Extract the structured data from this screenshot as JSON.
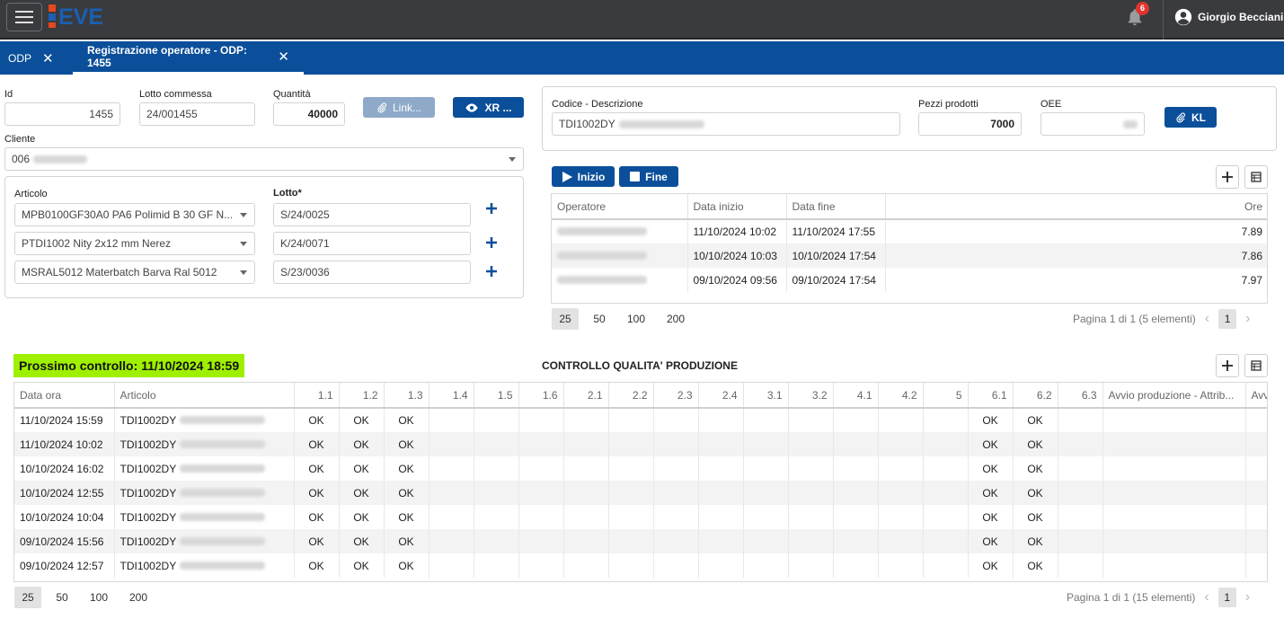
{
  "header": {
    "logo_text": "EVE",
    "notifications_count": "6",
    "user_name": "Giorgio Becciani"
  },
  "tabs": [
    {
      "label": "ODP"
    },
    {
      "label": "Registrazione operatore - ODP: 1455"
    }
  ],
  "form": {
    "id_label": "Id",
    "id_value": "1455",
    "lotto_commessa_label": "Lotto commessa",
    "lotto_commessa_value": "24/001455",
    "quantita_label": "Quantità",
    "quantita_value": "40000",
    "link_button": "Link...",
    "xr_button": "XR ...",
    "cliente_label": "Cliente",
    "cliente_value": "006",
    "articolo_label": "Articolo",
    "lotto_label": "Lotto*",
    "articles": [
      {
        "articolo": "MPB0100GF30A0 PA6 Polimid B 30 GF N...",
        "lotto": "S/24/0025"
      },
      {
        "articolo": "PTDI1002 Nity 2x12 mm Nerez",
        "lotto": "K/24/0071"
      },
      {
        "articolo": "MSRAL5012 Materbatch Barva Ral 5012",
        "lotto": "S/23/0036"
      }
    ]
  },
  "product": {
    "codice_label": "Codice - Descrizione",
    "codice_value": "TDI1002DY",
    "pezzi_label": "Pezzi prodotti",
    "pezzi_value": "7000",
    "oee_label": "OEE",
    "kl_button": "KL"
  },
  "operators": {
    "start_button": "Inizio",
    "end_button": "Fine",
    "columns": [
      "Operatore",
      "Data inizio",
      "Data fine",
      "Ore"
    ],
    "rows": [
      {
        "start": "11/10/2024 10:02",
        "end": "11/10/2024 17:55",
        "hours": "7.89"
      },
      {
        "start": "10/10/2024 10:03",
        "end": "10/10/2024 17:54",
        "hours": "7.86"
      },
      {
        "start": "09/10/2024 09:56",
        "end": "09/10/2024 17:54",
        "hours": "7.97"
      }
    ],
    "page_sizes": [
      "25",
      "50",
      "100",
      "200"
    ],
    "page_info": "Pagina 1 di 1 (5 elementi)",
    "page": "1"
  },
  "quality": {
    "next_control": "Prossimo controllo: 11/10/2024 18:59",
    "title": "CONTROLLO QUALITA' PRODUZIONE",
    "columns": [
      "Data ora",
      "Articolo",
      "1.1",
      "1.2",
      "1.3",
      "1.4",
      "1.5",
      "1.6",
      "2.1",
      "2.2",
      "2.3",
      "2.4",
      "3.1",
      "3.2",
      "4.1",
      "4.2",
      "5",
      "6.1",
      "6.2",
      "6.3",
      "Avvio produzione - Attrib...",
      "Avvi"
    ],
    "rows": [
      {
        "date": "11/10/2024 15:59",
        "article": "TDI1002DY",
        "ok": "OK"
      },
      {
        "date": "11/10/2024 10:02",
        "article": "TDI1002DY",
        "ok": "OK"
      },
      {
        "date": "10/10/2024 16:02",
        "article": "TDI1002DY",
        "ok": "OK"
      },
      {
        "date": "10/10/2024 12:55",
        "article": "TDI1002DY",
        "ok": "OK"
      },
      {
        "date": "10/10/2024 10:04",
        "article": "TDI1002DY",
        "ok": "OK"
      },
      {
        "date": "09/10/2024 15:56",
        "article": "TDI1002DY",
        "ok": "OK"
      },
      {
        "date": "09/10/2024 12:57",
        "article": "TDI1002DY",
        "ok": "OK"
      }
    ],
    "page_sizes": [
      "25",
      "50",
      "100",
      "200"
    ],
    "page_info": "Pagina 1 di 1 (15 elementi)",
    "page": "1"
  },
  "colors": {
    "primary": "#0b4f9a",
    "topbar": "#3a3b3e",
    "highlight": "#9ef000",
    "badge": "#e0342f"
  }
}
